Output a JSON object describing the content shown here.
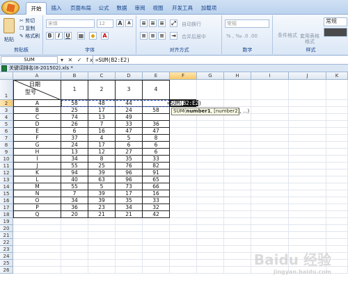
{
  "ribbon_tabs": [
    "开始",
    "插入",
    "页面布局",
    "公式",
    "数据",
    "审阅",
    "视图",
    "开发工具",
    "加载项"
  ],
  "clipboard": {
    "paste": "粘贴",
    "cut": "剪切",
    "copy": "复制",
    "painter": "格式刷",
    "label": "剪贴板"
  },
  "font": {
    "name": "宋体",
    "size": "12",
    "label": "字体"
  },
  "alignment": {
    "wrap": "自动换行",
    "merge": "合并后居中",
    "label": "对齐方式"
  },
  "number": {
    "format": "常规",
    "label": "数字"
  },
  "styles": {
    "cond": "条件格式",
    "table": "套用表格格式",
    "normal": "常规",
    "label": "样式"
  },
  "name_box": "SUM",
  "formula_buttons": "▾ ✕ ✓ fx",
  "formula_text": "=SUM(B2:E2)",
  "workbook_title": "关键词排名(8-201502).xls *",
  "columns": [
    "A",
    "B",
    "C",
    "D",
    "E",
    "F",
    "G",
    "H",
    "I",
    "J",
    "K"
  ],
  "header_row": {
    "a_top": "日期",
    "a_bottom": "型号",
    "b": "1",
    "c": "2",
    "d": "3",
    "e": "4"
  },
  "rows": [
    [
      "A",
      "58",
      "48",
      "44",
      ""
    ],
    [
      "B",
      "25",
      "17",
      "24",
      "58"
    ],
    [
      "C",
      "74",
      "13",
      "49",
      ""
    ],
    [
      "D",
      "26",
      "7",
      "33",
      "36"
    ],
    [
      "E",
      "6",
      "16",
      "47",
      "47"
    ],
    [
      "F",
      "37",
      "4",
      "5",
      "8"
    ],
    [
      "G",
      "24",
      "17",
      "6",
      "6"
    ],
    [
      "H",
      "13",
      "12",
      "27",
      "6"
    ],
    [
      "I",
      "34",
      "8",
      "35",
      "33"
    ],
    [
      "J",
      "55",
      "25",
      "76",
      "82"
    ],
    [
      "K",
      "94",
      "39",
      "96",
      "91"
    ],
    [
      "L",
      "40",
      "63",
      "96",
      "65"
    ],
    [
      "M",
      "55",
      "5",
      "73",
      "66"
    ],
    [
      "N",
      "7",
      "39",
      "17",
      "16"
    ],
    [
      "O",
      "34",
      "39",
      "35",
      "33"
    ],
    [
      "P",
      "36",
      "23",
      "34",
      "32"
    ],
    [
      "Q",
      "20",
      "21",
      "21",
      "42"
    ]
  ],
  "total_rows": 26,
  "formula_in_cell": {
    "prefix": "=SUM(",
    "range": "B2:E2",
    "suffix": ")"
  },
  "tooltip": {
    "fn": "SUM(",
    "arg1": "number1",
    "rest": ", [number2], ...)"
  },
  "watermark": "Baidu 经验",
  "watermark_sub": "jingyan.baidu.com"
}
